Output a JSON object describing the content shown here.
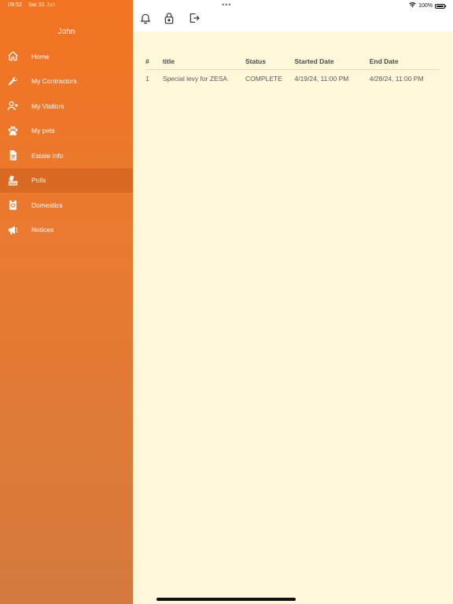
{
  "status_bar": {
    "time": "09:52",
    "date": "Sat 01 Jun",
    "battery": "100%"
  },
  "sidebar": {
    "user_name": "John",
    "items": [
      {
        "label": "Home",
        "icon": "home-icon"
      },
      {
        "label": "My Contractors",
        "icon": "wrench-icon"
      },
      {
        "label": "My Visitors",
        "icon": "add-person-icon"
      },
      {
        "label": "My pets",
        "icon": "paw-icon"
      },
      {
        "label": "Estate Info",
        "icon": "document-icon"
      },
      {
        "label": "Polls",
        "icon": "ballot-icon",
        "active": true
      },
      {
        "label": "Domestics",
        "icon": "clipboard-icon"
      },
      {
        "label": "Notices",
        "icon": "megaphone-icon"
      }
    ]
  },
  "toolbar": {
    "icons": [
      "bell-icon",
      "lock-icon",
      "logout-icon"
    ]
  },
  "table": {
    "headers": [
      "#",
      "title",
      "Status",
      "Started Date",
      "End Date"
    ],
    "rows": [
      [
        "1",
        "Special levy for ZESA",
        "COMPLETE",
        "4/19/24, 11:00 PM",
        "4/28/24, 11:00 PM"
      ]
    ]
  },
  "colors": {
    "accent": "#f27321",
    "sidebar_bottom": "#d47a3e",
    "content_bg": "#fff7d9"
  }
}
